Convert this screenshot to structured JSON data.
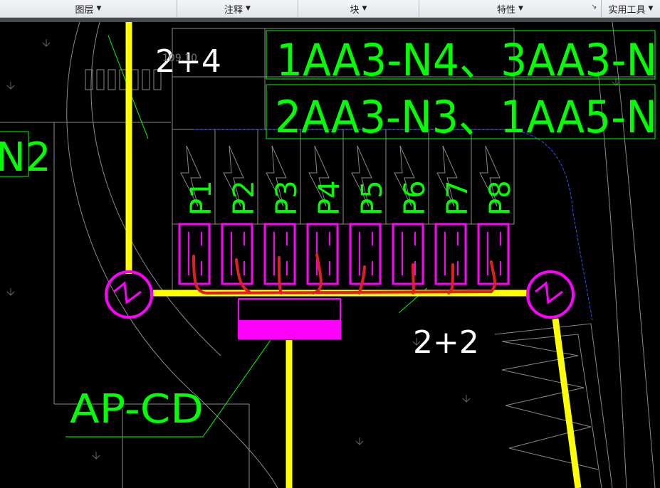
{
  "ribbon": {
    "panels": [
      {
        "label": "图层"
      },
      {
        "label": "注释"
      },
      {
        "label": "块"
      },
      {
        "label": "特性"
      },
      {
        "label": "实用工具"
      }
    ],
    "dropdown_icon": "triangle-down",
    "dialog_launcher_icon": "arrow-down-right"
  },
  "drawing": {
    "cable_top_left": "2+4",
    "elevation": "109.10",
    "circuit_line_1": "1AA3-N4、3AA3-N",
    "circuit_line_2": "2AA3-N3、1AA5-N",
    "left_label": "N2",
    "cable_bottom_right": "2+2",
    "panel_name": "AP-CD",
    "circuits": [
      "P1",
      "P2",
      "P3",
      "P4",
      "P5",
      "P6",
      "P7",
      "P8"
    ],
    "colors": {
      "background": "#000000",
      "bus": "#ffff00",
      "equipment": "#ff00ff",
      "text": "#00ff00",
      "markup": "#e02020",
      "linework": "#808080"
    }
  }
}
